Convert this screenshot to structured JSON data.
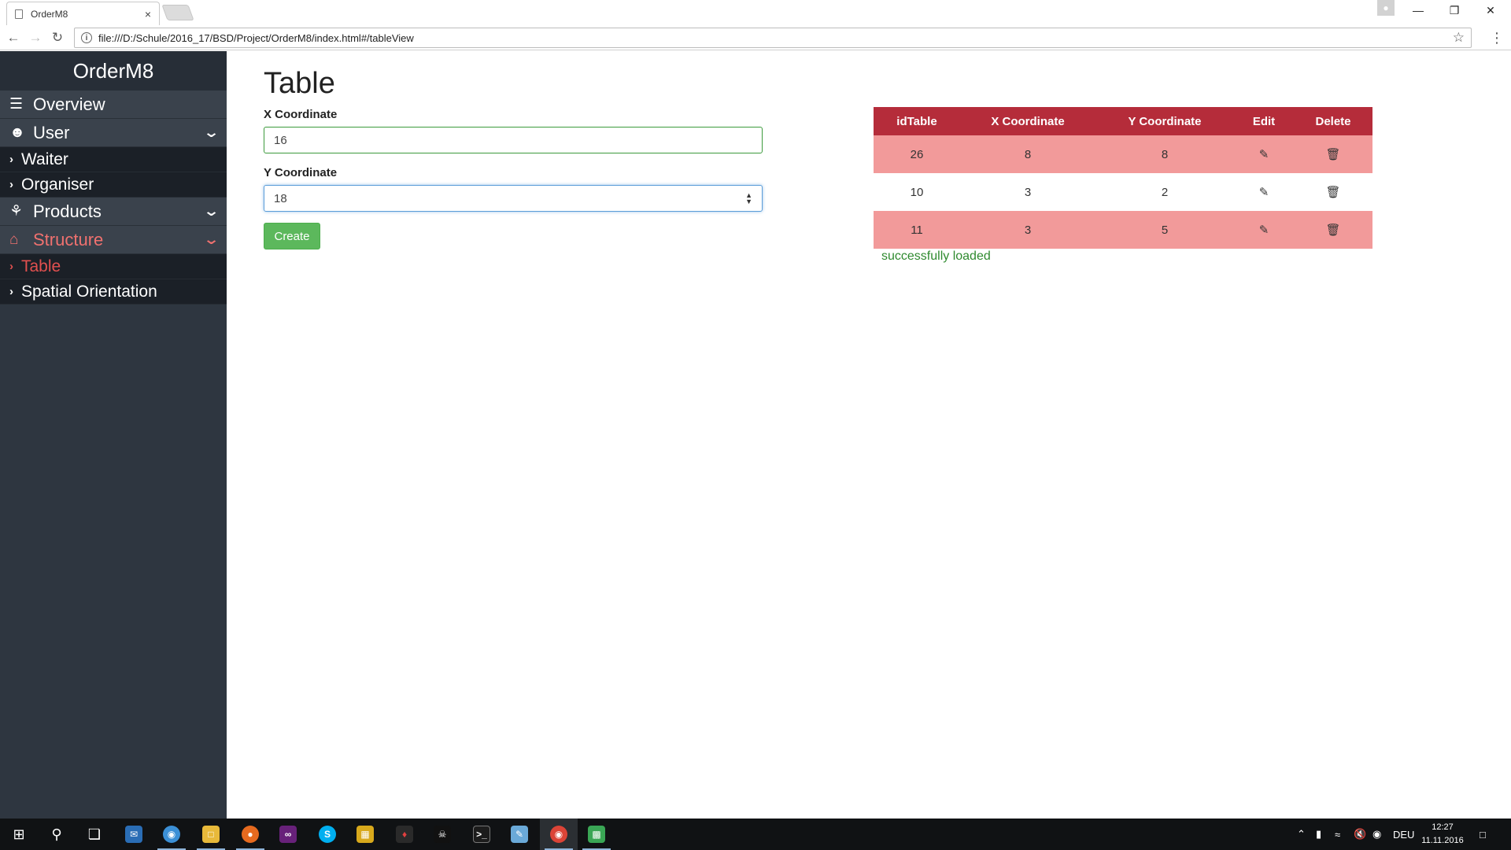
{
  "browser": {
    "tab_title": "OrderM8",
    "tab_close": "×",
    "url": "file:///D:/Schule/2016_17/BSD/Project/OrderM8/index.html#/tableView",
    "info_icon": "i"
  },
  "sidebar": {
    "brand": "OrderM8",
    "items": [
      {
        "label": "Overview",
        "icon": "list-icon"
      },
      {
        "label": "User",
        "icon": "user-icon"
      },
      {
        "label": "Waiter"
      },
      {
        "label": "Organiser"
      },
      {
        "label": "Products",
        "icon": "cutlery-icon"
      },
      {
        "label": "Structure",
        "icon": "home-icon"
      },
      {
        "label": "Table"
      },
      {
        "label": "Spatial Orientation"
      }
    ]
  },
  "main": {
    "title": "Table",
    "x_label": "X Coordinate",
    "x_value": "16",
    "y_label": "Y Coordinate",
    "y_value": "18",
    "create_label": "Create",
    "table": {
      "headers": [
        "idTable",
        "X Coordinate",
        "Y Coordinate",
        "Edit",
        "Delete"
      ],
      "rows": [
        {
          "id": "26",
          "x": "8",
          "y": "8",
          "style": "danger"
        },
        {
          "id": "10",
          "x": "3",
          "y": "2",
          "style": "plain"
        },
        {
          "id": "11",
          "x": "3",
          "y": "5",
          "style": "danger"
        }
      ]
    },
    "status": "successfully loaded"
  },
  "taskbar": {
    "language": "DEU",
    "time": "12:27",
    "date": "11.11.2016"
  },
  "colors": {
    "sidebar_bg": "#2e3640",
    "table_header": "#b52c3a",
    "row_danger": "#f29a9a",
    "active_nav": "#e2504f",
    "create_button": "#5cb85c",
    "status_text": "#2f8a2f"
  }
}
